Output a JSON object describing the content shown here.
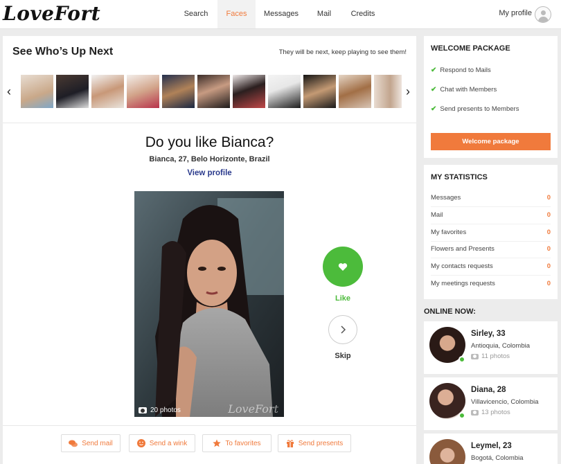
{
  "app": {
    "logo": "LoveFort"
  },
  "nav": {
    "items": [
      {
        "label": "Search",
        "active": false
      },
      {
        "label": "Faces",
        "active": true
      },
      {
        "label": "Messages",
        "active": false
      },
      {
        "label": "Mail",
        "active": false
      },
      {
        "label": "Credits",
        "active": false
      }
    ],
    "profile_label": "My profile"
  },
  "upnext": {
    "title": "See Who’s Up Next",
    "note": "They will be next, keep playing to see them!",
    "thumb_count": 11
  },
  "match": {
    "question": "Do you like Bianca?",
    "details": "Bianca, 27, Belo Horizonte, Brazil",
    "view_profile": "View profile",
    "photo_count": "20 photos",
    "watermark": "LoveFort",
    "like_label": "Like",
    "skip_label": "Skip"
  },
  "actions": [
    {
      "label": "Send mail",
      "icon": "chat-bubbles-icon"
    },
    {
      "label": "Send a wink",
      "icon": "smiley-icon"
    },
    {
      "label": "To favorites",
      "icon": "star-icon"
    },
    {
      "label": "Send presents",
      "icon": "gift-icon"
    }
  ],
  "welcome": {
    "title": "WELCOME PACKAGE",
    "items": [
      "Respond to Mails",
      "Chat with Members",
      "Send presents to Members"
    ],
    "button": "Welcome package"
  },
  "stats": {
    "title": "MY STATISTICS",
    "rows": [
      {
        "label": "Messages",
        "value": "0"
      },
      {
        "label": "Mail",
        "value": "0"
      },
      {
        "label": "My favorites",
        "value": "0"
      },
      {
        "label": "Flowers and Presents",
        "value": "0"
      },
      {
        "label": "My contacts requests",
        "value": "0"
      },
      {
        "label": "My meetings requests",
        "value": "0"
      }
    ]
  },
  "online": {
    "title": "ONLINE NOW:",
    "members": [
      {
        "name": "Sirley, 33",
        "location": "Antioquia, Colombia",
        "photos": "11 photos"
      },
      {
        "name": "Diana, 28",
        "location": "Villavicencio, Colombia",
        "photos": "13 photos"
      },
      {
        "name": "Leymel, 23",
        "location": "Bogotá, Colombia",
        "photos": ""
      }
    ]
  },
  "colors": {
    "accent": "#f07a3c",
    "like": "#4cbb3b",
    "link": "#2a3a8c"
  }
}
